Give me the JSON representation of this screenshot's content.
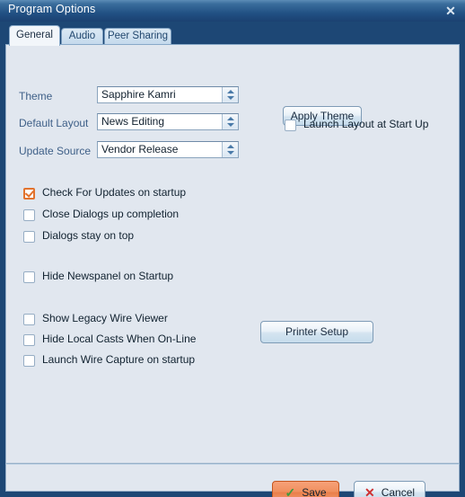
{
  "window": {
    "title": "Program Options",
    "close_icon": "close-icon"
  },
  "tabs": [
    {
      "label": "General",
      "active": true
    },
    {
      "label": "Audio",
      "active": false
    },
    {
      "label": "Peer Sharing",
      "active": false
    }
  ],
  "general": {
    "fields": [
      {
        "label": "Theme",
        "value": "Sapphire Kamri"
      },
      {
        "label": "Default Layout",
        "value": "News Editing"
      },
      {
        "label": "Update Source",
        "value": "Vendor Release"
      }
    ],
    "apply_theme_button": "Apply Theme",
    "launch_layout_checkbox": {
      "label": "Launch Layout at Start Up",
      "checked": false
    },
    "printer_setup_button": "Printer Setup",
    "checkboxes_group_one": [
      {
        "label": "Check For Updates on startup",
        "checked": true
      },
      {
        "label": "Close Dialogs up completion",
        "checked": false
      },
      {
        "label": "Dialogs stay on top",
        "checked": false
      }
    ],
    "checkboxes_group_two": [
      {
        "label": "Hide Newspanel on Startup",
        "checked": false
      }
    ],
    "checkboxes_group_three": [
      {
        "label": "Show Legacy Wire Viewer",
        "checked": false
      },
      {
        "label": "Hide Local Casts When On-Line",
        "checked": false
      },
      {
        "label": "Launch Wire Capture on startup",
        "checked": false
      }
    ]
  },
  "footer": {
    "save_label": "Save",
    "save_icon": "check-icon",
    "cancel_label": "Cancel",
    "cancel_icon": "x-icon"
  },
  "colors": {
    "titlebar_dark": "#1d4775",
    "titlebar_light": "#5c8cb6",
    "panel_bg": "#e1e7ef",
    "label_text": "#3f6088",
    "accent_orange": "#e2732e",
    "save_orange": "#ea7f4a",
    "check_green": "#3d9a3d",
    "cancel_red": "#cf2f2f"
  }
}
